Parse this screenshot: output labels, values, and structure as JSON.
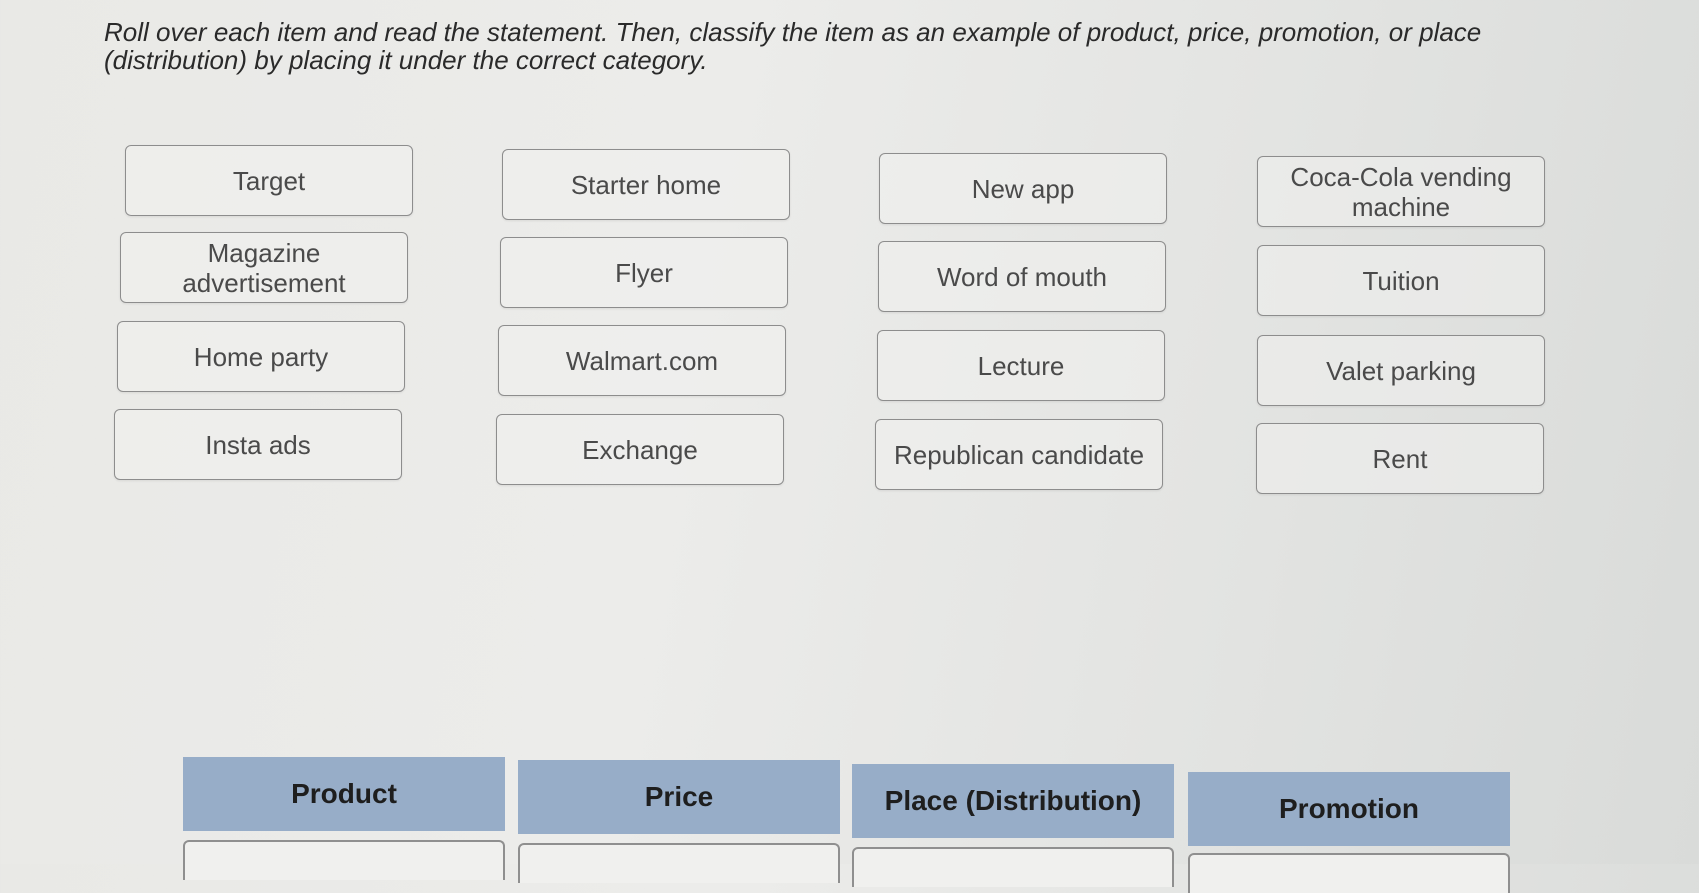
{
  "instructions": "Roll over each item and read the statement. Then, classify the item as an example of product, price, promotion, or place (distribution) by placing it under the correct category.",
  "items": [
    {
      "label": "Target"
    },
    {
      "label": "Starter home"
    },
    {
      "label": "New app"
    },
    {
      "label": "Coca-Cola vending machine"
    },
    {
      "label": "Magazine advertisement"
    },
    {
      "label": "Flyer"
    },
    {
      "label": "Word of mouth"
    },
    {
      "label": "Tuition"
    },
    {
      "label": "Home party"
    },
    {
      "label": "Walmart.com"
    },
    {
      "label": "Lecture"
    },
    {
      "label": "Valet parking"
    },
    {
      "label": "Insta ads"
    },
    {
      "label": "Exchange"
    },
    {
      "label": "Republican candidate"
    },
    {
      "label": "Rent"
    }
  ],
  "categories": [
    {
      "label": "Product"
    },
    {
      "label": "Price"
    },
    {
      "label": "Place (Distribution)"
    },
    {
      "label": "Promotion"
    }
  ]
}
